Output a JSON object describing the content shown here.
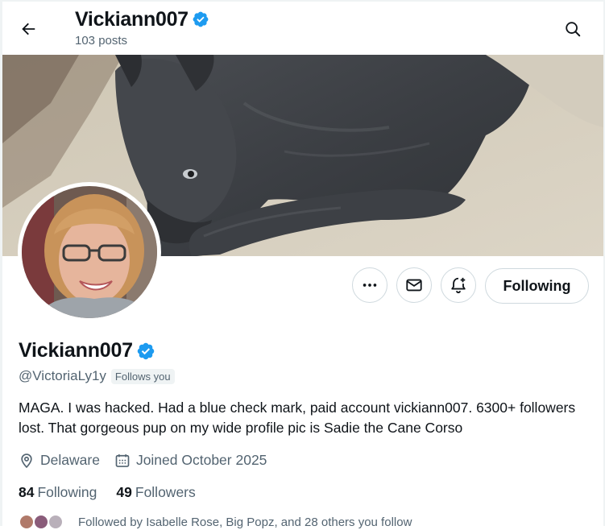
{
  "header": {
    "title": "Vickiann007",
    "posts_count": "103 posts"
  },
  "profile": {
    "display_name": "Vickiann007",
    "handle": "@VictoriaLy1y",
    "follows_you": "Follows you",
    "bio": "MAGA. I was hacked. Had a blue check mark, paid account vickiann007. 6300+ followers lost. That gorgeous pup on my wide profile pic is Sadie the Cane Corso",
    "location": "Delaware",
    "joined": "Joined October 2025",
    "following_count": "84",
    "following_label": "Following",
    "followers_count": "49",
    "followers_label": "Followers",
    "followed_by": "Followed by Isabelle Rose, Big Popz, and 28 others you follow"
  },
  "actions": {
    "follow_state_label": "Following"
  },
  "colors": {
    "verified": "#1d9bf0",
    "text_primary": "#0f1419",
    "text_secondary": "#536471",
    "border": "#cfd9de"
  },
  "icons": [
    "back-arrow-icon",
    "verified-badge-icon",
    "search-icon",
    "more-icon",
    "mail-icon",
    "notification-add-icon",
    "location-icon",
    "calendar-icon"
  ]
}
